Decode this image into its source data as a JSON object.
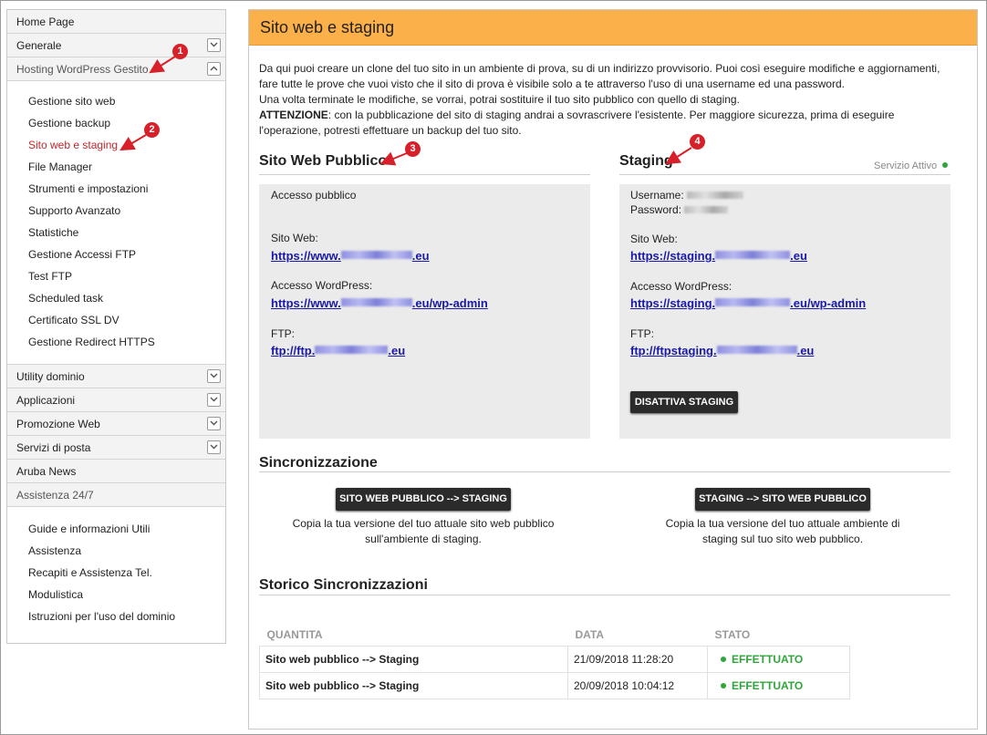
{
  "sidebar": {
    "top_items": [
      {
        "label": "Home Page"
      },
      {
        "label": "Generale"
      },
      {
        "label": "Hosting WordPress Gestito"
      }
    ],
    "hosting_sub": [
      {
        "label": "Gestione sito web"
      },
      {
        "label": "Gestione backup"
      },
      {
        "label": "Sito web e staging"
      },
      {
        "label": "File Manager"
      },
      {
        "label": "Strumenti e impostazioni"
      },
      {
        "label": "Supporto Avanzato"
      },
      {
        "label": "Statistiche"
      },
      {
        "label": "Gestione Accessi FTP"
      },
      {
        "label": "Test FTP"
      },
      {
        "label": "Scheduled task"
      },
      {
        "label": "Certificato SSL DV"
      },
      {
        "label": "Gestione Redirect HTTPS"
      }
    ],
    "mid_items": [
      {
        "label": "Utility dominio"
      },
      {
        "label": "Applicazioni"
      },
      {
        "label": "Promozione Web"
      },
      {
        "label": "Servizi di posta"
      },
      {
        "label": "Aruba News"
      },
      {
        "label": "Assistenza 24/7"
      }
    ],
    "assist_sub": [
      {
        "label": "Guide e informazioni Utili"
      },
      {
        "label": "Assistenza"
      },
      {
        "label": "Recapiti e Assistenza Tel."
      },
      {
        "label": "Modulistica"
      },
      {
        "label": "Istruzioni per l'uso del dominio"
      }
    ]
  },
  "page": {
    "title": "Sito web e staging",
    "intro_line1": "Da qui puoi creare un clone del tuo sito in un ambiente di prova, su di un indirizzo provvisorio. Puoi così eseguire modifiche e aggiornamenti,",
    "intro_line2": "fare tutte le prove che vuoi visto che il sito di prova è visibile solo a te attraverso l'uso di una username ed una password.",
    "intro_line3": "Una volta terminate le modifiche, se vorrai, potrai sostituire il tuo sito pubblico con quello di staging.",
    "attention_label": "ATTENZIONE",
    "attention_text": ": con la pubblicazione del sito di staging andrai a sovrascrivere l'esistente. Per maggiore sicurezza, prima di eseguire",
    "attention_line2": "l'operazione, potresti effettuare un backup del tuo sito."
  },
  "public_site": {
    "title": "Sito Web Pubblico",
    "access": "Accesso pubblico",
    "site_label": "Sito Web:",
    "site_prefix": "https://www.",
    "site_suffix": ".eu",
    "wp_label": "Accesso WordPress:",
    "wp_prefix": "https://www.",
    "wp_suffix": ".eu/wp-admin",
    "ftp_label": "FTP:",
    "ftp_prefix": "ftp://ftp.",
    "ftp_suffix": ".eu"
  },
  "staging": {
    "title": "Staging",
    "status": "Servizio Attivo",
    "username_label": "Username:",
    "password_label": "Password:",
    "site_label": "Sito Web:",
    "site_prefix": "https://staging.",
    "site_suffix": ".eu",
    "wp_label": "Accesso WordPress:",
    "wp_prefix": "https://staging.",
    "wp_suffix": ".eu/wp-admin",
    "ftp_label": "FTP:",
    "ftp_prefix": "ftp://ftpstaging.",
    "ftp_suffix": ".eu",
    "deactivate_button": "DISATTIVA STAGING"
  },
  "sync": {
    "title": "Sincronizzazione",
    "to_staging_button": "SITO WEB PUBBLICO --> STAGING",
    "to_staging_desc1": "Copia la tua versione del tuo attuale sito web pubblico",
    "to_staging_desc2": "sull'ambiente di staging.",
    "to_public_button": "STAGING --> SITO WEB PUBBLICO",
    "to_public_desc1": "Copia la tua versione del tuo attuale ambiente di",
    "to_public_desc2": "staging sul tuo sito web pubblico."
  },
  "history": {
    "title": "Storico Sincronizzazioni",
    "columns": [
      "QUANTITA",
      "DATA",
      "STATO"
    ],
    "rows": [
      {
        "what": "Sito web pubblico --> Staging",
        "date": "21/09/2018 11:28:20",
        "status": "EFFETTUATO"
      },
      {
        "what": "Sito web pubblico --> Staging",
        "date": "20/09/2018 10:04:12",
        "status": "EFFETTUATO"
      }
    ]
  },
  "markers": [
    "1",
    "2",
    "3",
    "4"
  ],
  "colors": {
    "header": "#fbb04a",
    "link": "#1a1aa6",
    "active_menu": "#c0272d",
    "success": "#2fa53a",
    "marker": "#d8202a"
  }
}
